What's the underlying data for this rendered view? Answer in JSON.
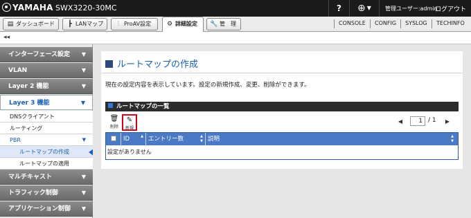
{
  "header": {
    "brand": "YAMAHA",
    "model": "SWX3220-30MC",
    "help_label": "?",
    "language_icon": "globe-icon",
    "user_label": "管理ユーザー:admin",
    "logout_label": "ログアウト"
  },
  "tabs": [
    {
      "label": "ダッシュボード",
      "icon": "dashboard-icon"
    },
    {
      "label": "LANマップ",
      "icon": "lanmap-icon"
    },
    {
      "label": "ProAV設定",
      "icon": "sliders-icon"
    },
    {
      "label": "詳細設定",
      "icon": "gear-icon",
      "active": true
    },
    {
      "label": "管　理",
      "icon": "wrench-icon"
    }
  ],
  "right_links": [
    "CONSOLE",
    "CONFIG",
    "SYSLOG",
    "TECHINFO"
  ],
  "collapse_label": "◂◂",
  "sidebar": {
    "groups": [
      {
        "label": "インターフェース設定"
      },
      {
        "label": "VLAN"
      },
      {
        "label": "Layer 2 機能"
      },
      {
        "label": "Layer 3 機能",
        "open": true
      },
      {
        "label": "マルチキャスト"
      },
      {
        "label": "トラフィック制御"
      },
      {
        "label": "アプリケーション制御"
      }
    ],
    "layer3_items": [
      {
        "label": "DNSクライアント"
      },
      {
        "label": "ルーティング"
      },
      {
        "label": "PBR"
      },
      {
        "label": "ルートマップの作成",
        "selected": true
      },
      {
        "label": "ルートマップの適用"
      }
    ]
  },
  "main": {
    "title": "ルートマップの作成",
    "description": "現在の設定内容を表示しています。設定の新規作成、変更、削除ができます。",
    "list_title": "ルートマップの一覧",
    "toolbar": {
      "delete_label": "削除",
      "new_label": "新規"
    },
    "pager": {
      "current": "1",
      "separator": "/",
      "total": "1"
    },
    "table": {
      "columns": [
        "ID",
        "エントリー数",
        "説明"
      ],
      "empty_message": "設定がありません"
    }
  },
  "colors": {
    "accent": "#1a5fb4",
    "header_bg": "#1b1b1b",
    "table_header": "#4a7ac6",
    "highlight_border": "#d0021b"
  }
}
